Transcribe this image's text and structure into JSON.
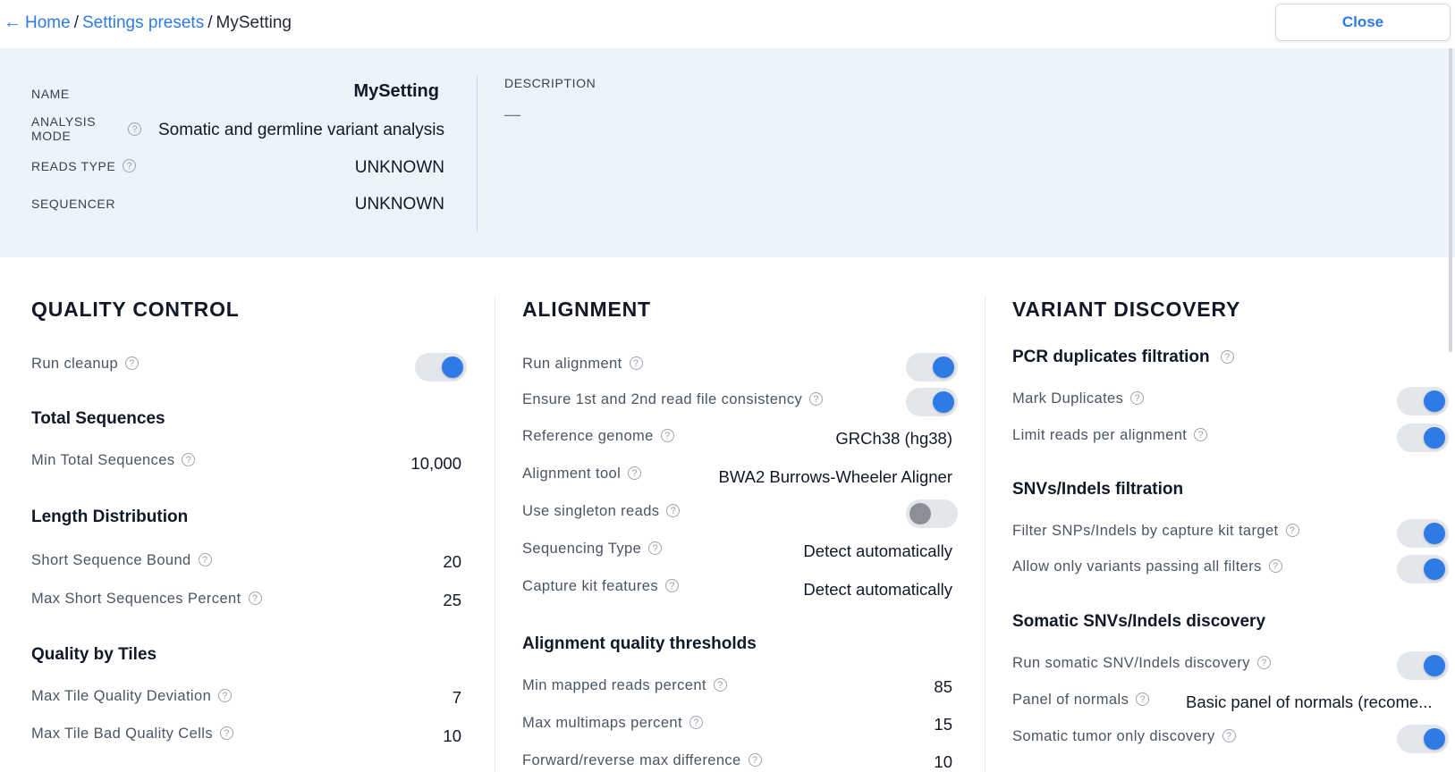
{
  "breadcrumb": {
    "home": "Home",
    "presets": "Settings presets",
    "current": "MySetting",
    "separator": "/"
  },
  "close_label": "Close",
  "summary": {
    "name_label": "NAME",
    "name_value": "MySetting",
    "analysis_label_1": "ANALYSIS",
    "analysis_label_2": "MODE",
    "analysis_value": "Somatic and germline variant analysis",
    "reads_label": "READS TYPE",
    "reads_value": "UNKNOWN",
    "sequencer_label": "SEQUENCER",
    "sequencer_value": "UNKNOWN",
    "description_label": "DESCRIPTION",
    "description_value": "—"
  },
  "help_glyph": "?",
  "qc": {
    "title": "QUALITY CONTROL",
    "run_cleanup": {
      "label": "Run cleanup",
      "on": true
    },
    "total_title": "Total Sequences",
    "min_total": {
      "label": "Min Total Sequences",
      "value": "10,000"
    },
    "length_title": "Length Distribution",
    "short_bound": {
      "label": "Short Sequence Bound",
      "value": "20"
    },
    "max_short": {
      "label": "Max Short Sequences Percent",
      "value": "25"
    },
    "tiles_title": "Quality by Tiles",
    "tile_dev": {
      "label": "Max Tile Quality Deviation",
      "value": "7"
    },
    "tile_bad": {
      "label": "Max Tile Bad Quality Cells",
      "value": "10"
    }
  },
  "alignment": {
    "title": "ALIGNMENT",
    "run_alignment": {
      "label": "Run alignment",
      "on": true
    },
    "consistency": {
      "label": "Ensure 1st and 2nd read file consistency",
      "on": true
    },
    "ref_genome": {
      "label": "Reference genome",
      "value": "GRCh38 (hg38)"
    },
    "tool": {
      "label": "Alignment tool",
      "value": "BWA2 Burrows-Wheeler Aligner"
    },
    "singleton": {
      "label": "Use singleton reads",
      "on": false
    },
    "seq_type": {
      "label": "Sequencing Type",
      "value": "Detect automatically"
    },
    "capture": {
      "label": "Capture kit features",
      "value": "Detect automatically"
    },
    "thresholds_title": "Alignment quality thresholds",
    "min_mapped": {
      "label": "Min mapped reads percent",
      "value": "85"
    },
    "max_multimaps": {
      "label": "Max multimaps percent",
      "value": "15"
    },
    "fr_diff": {
      "label": "Forward/reverse max difference",
      "value": "10"
    }
  },
  "variant": {
    "title": "VARIANT DISCOVERY",
    "pcr_title": "PCR duplicates filtration",
    "mark_dup": {
      "label": "Mark Duplicates",
      "on": true
    },
    "limit_reads": {
      "label": "Limit reads per alignment",
      "on": true
    },
    "snv_title": "SNVs/Indels filtration",
    "filter_capture": {
      "label": "Filter SNPs/Indels by capture kit target",
      "on": true
    },
    "allow_passing": {
      "label": "Allow only variants passing all filters",
      "on": true
    },
    "somatic_title": "Somatic SNVs/Indels discovery",
    "run_somatic": {
      "label": "Run somatic SNV/Indels discovery",
      "on": true
    },
    "panel": {
      "label": "Panel of normals",
      "value": "Basic panel of normals (recome..."
    },
    "tumor_only": {
      "label": "Somatic tumor only discovery",
      "on": true
    }
  }
}
